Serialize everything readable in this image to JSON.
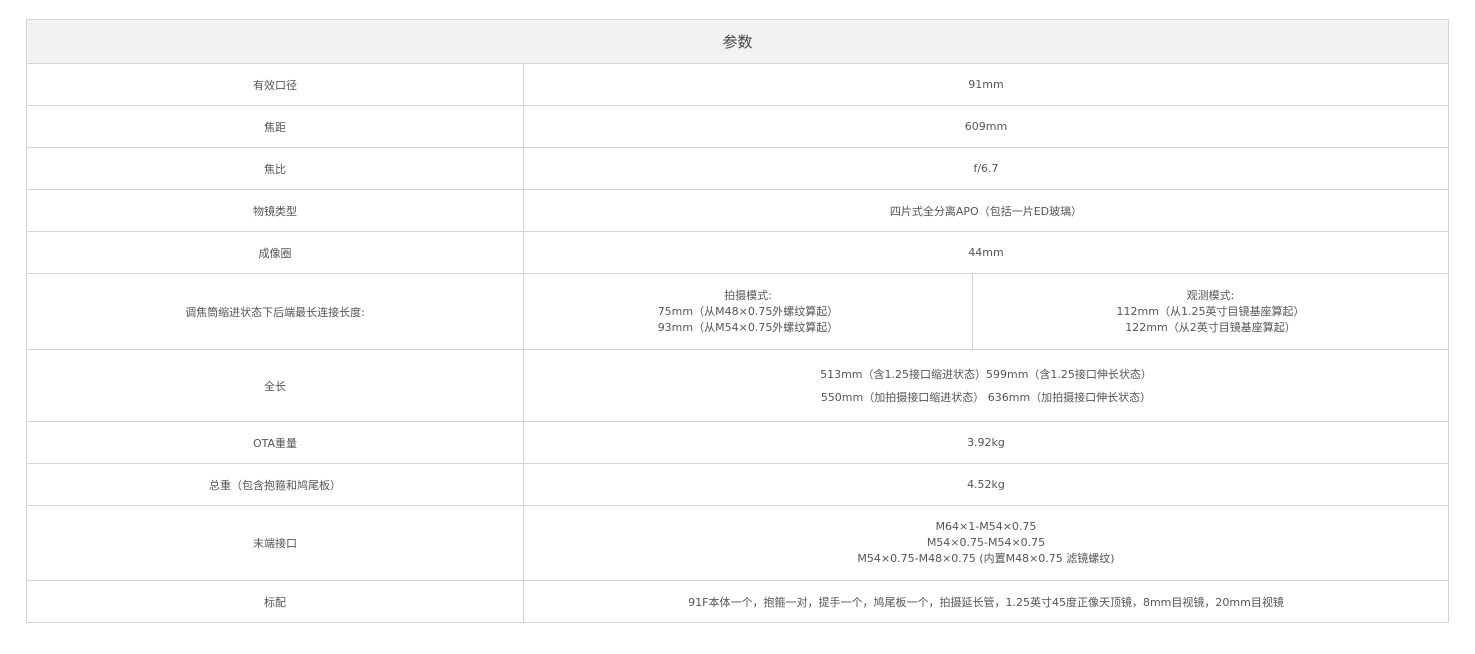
{
  "table": {
    "header": "参数",
    "rows": {
      "aperture": {
        "label": "有效口径",
        "value": "91mm"
      },
      "focal_length": {
        "label": "焦距",
        "value": "609mm"
      },
      "focal_ratio": {
        "label": "焦比",
        "value": "f/6.7"
      },
      "objective_type": {
        "label": "物镜类型",
        "value": "四片式全分离APO（包括一片ED玻璃）"
      },
      "image_circle": {
        "label": "成像圈",
        "value": "44mm"
      },
      "backfocus": {
        "label": "调焦筒缩进状态下后端最长连接长度:",
        "photo": {
          "title": "拍摄模式:",
          "lines": [
            "75mm（从M48×0.75外螺纹算起）",
            "93mm（从M54×0.75外螺纹算起）"
          ]
        },
        "visual": {
          "title": "观测模式:",
          "lines": [
            "112mm（从1.25英寸目镜基座算起）",
            "122mm（从2英寸目镜基座算起）"
          ]
        }
      },
      "total_length": {
        "label": "全长",
        "lines": [
          "513mm（含1.25接口缩进状态）599mm（含1.25接口伸长状态）",
          "550mm（加拍摄接口缩进状态） 636mm（加拍摄接口伸长状态）"
        ]
      },
      "ota_weight": {
        "label": "OTA重量",
        "value": "3.92kg"
      },
      "total_weight": {
        "label": "总重（包含抱箍和鸠尾板）",
        "value": "4.52kg"
      },
      "rear_interface": {
        "label": "末端接口",
        "lines": [
          "M64×1-M54×0.75",
          "M54×0.75-M54×0.75",
          "M54×0.75-M48×0.75 (内置M48×0.75 滤镜螺纹)"
        ]
      },
      "standard_config": {
        "label": "标配",
        "value": "91F本体一个，抱箍一对，提手一个，鸠尾板一个，拍摄延长管，1.25英寸45度正像天顶镜，8mm目视镜，20mm目视镜"
      }
    }
  }
}
